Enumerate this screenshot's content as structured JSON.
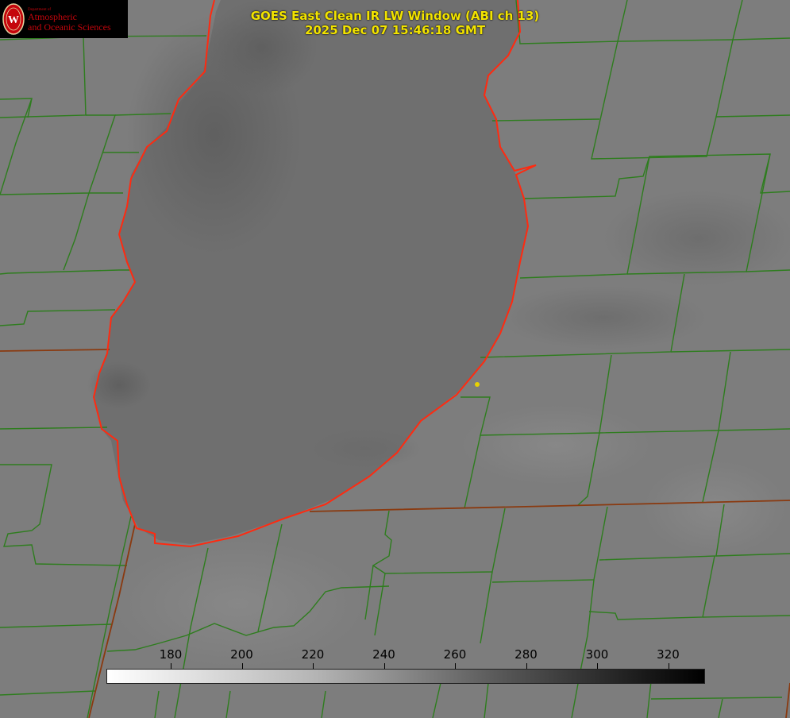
{
  "header": {
    "title": "GOES East Clean IR LW Window (ABI ch 13)",
    "timestamp": "2025 Dec 07 15:46:18 GMT"
  },
  "logo": {
    "dept": "Department of",
    "line1": "Atmospheric",
    "line2": "and Oceanic Sciences",
    "seal_letter": "W"
  },
  "colorbar": {
    "ticks": [
      "180",
      "200",
      "220",
      "240",
      "260",
      "280",
      "300",
      "320"
    ],
    "colors": [
      "#ffffff",
      "#000000"
    ]
  },
  "colors": {
    "lake_fill": "#6f6f6f",
    "land_fill": "#7d7d7d",
    "lake_outline": "#ff2a10",
    "borders": "#2e7d1e",
    "state_line": "#8a3a10",
    "title_text": "#f2e300",
    "marker": "#e8d200"
  }
}
